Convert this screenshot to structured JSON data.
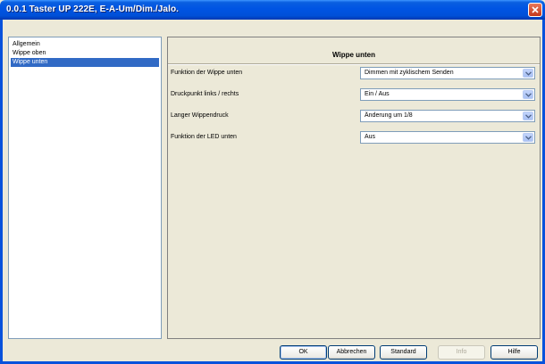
{
  "window": {
    "title": "0.0.1 Taster UP 222E, E-A-Um/Dim./Jalo."
  },
  "nav": {
    "items": [
      {
        "label": "Allgemein",
        "selected": false
      },
      {
        "label": "Wippe oben",
        "selected": false
      },
      {
        "label": "Wippe unten",
        "selected": true
      }
    ]
  },
  "content": {
    "title": "Wippe unten",
    "params": [
      {
        "label": "Funktion der Wippe unten",
        "value": "Dimmen mit zyklischem Senden"
      },
      {
        "label": "Druckpunkt links / rechts",
        "value": "Ein / Aus"
      },
      {
        "label": "Langer Wippendruck",
        "value": "Änderung um 1/8"
      },
      {
        "label": "Funktion der LED unten",
        "value": "Aus"
      }
    ]
  },
  "buttons": {
    "ok": "OK",
    "abbrechen": "Abbrechen",
    "standard": "Standard",
    "info": "Info",
    "hilfe": "Hilfe"
  },
  "colors": {
    "titlebar": "#0054e3",
    "selection": "#316ac5",
    "dialog_bg": "#ece9d8"
  }
}
